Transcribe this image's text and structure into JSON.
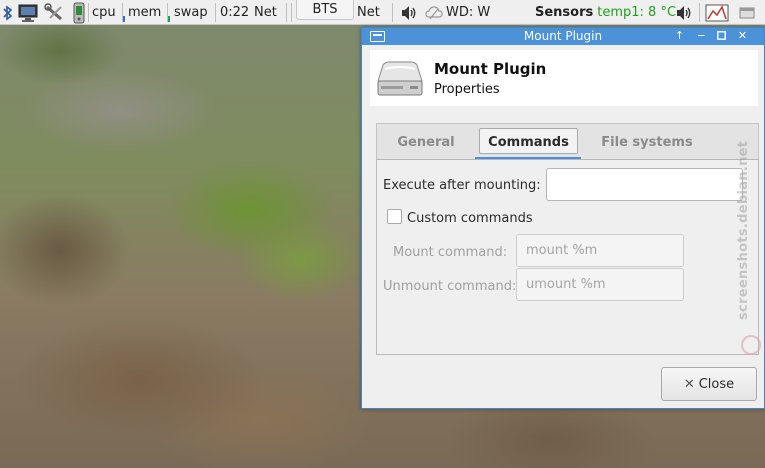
{
  "panel": {
    "cpu_label": "cpu",
    "mem_label": "mem",
    "swap_label": "swap",
    "clock": "0:22",
    "net_label_1": "Net",
    "bts_label": "BTS",
    "net_label_2": "Net",
    "weather": "WD: W",
    "sensors_label": "Sensors",
    "sensor_reading": "temp1: 8 °C",
    "accent_color": "#4a90d9"
  },
  "dialog": {
    "window_title": "Mount Plugin",
    "header_title": "Mount Plugin",
    "header_subtitle": "Properties",
    "tabs": [
      {
        "label": "General"
      },
      {
        "label": "Commands"
      },
      {
        "label": "File systems"
      }
    ],
    "active_tab": "Commands",
    "commands": {
      "execute_label": "Execute after mounting:",
      "execute_value": "",
      "custom_label": "Custom commands",
      "custom_checked": false,
      "mount_label": "Mount command:",
      "mount_value": "mount %m",
      "unmount_label": "Unmount command:",
      "unmount_value": "umount %m"
    },
    "close_label": "Close"
  },
  "watermark": "screenshots.debian.net"
}
